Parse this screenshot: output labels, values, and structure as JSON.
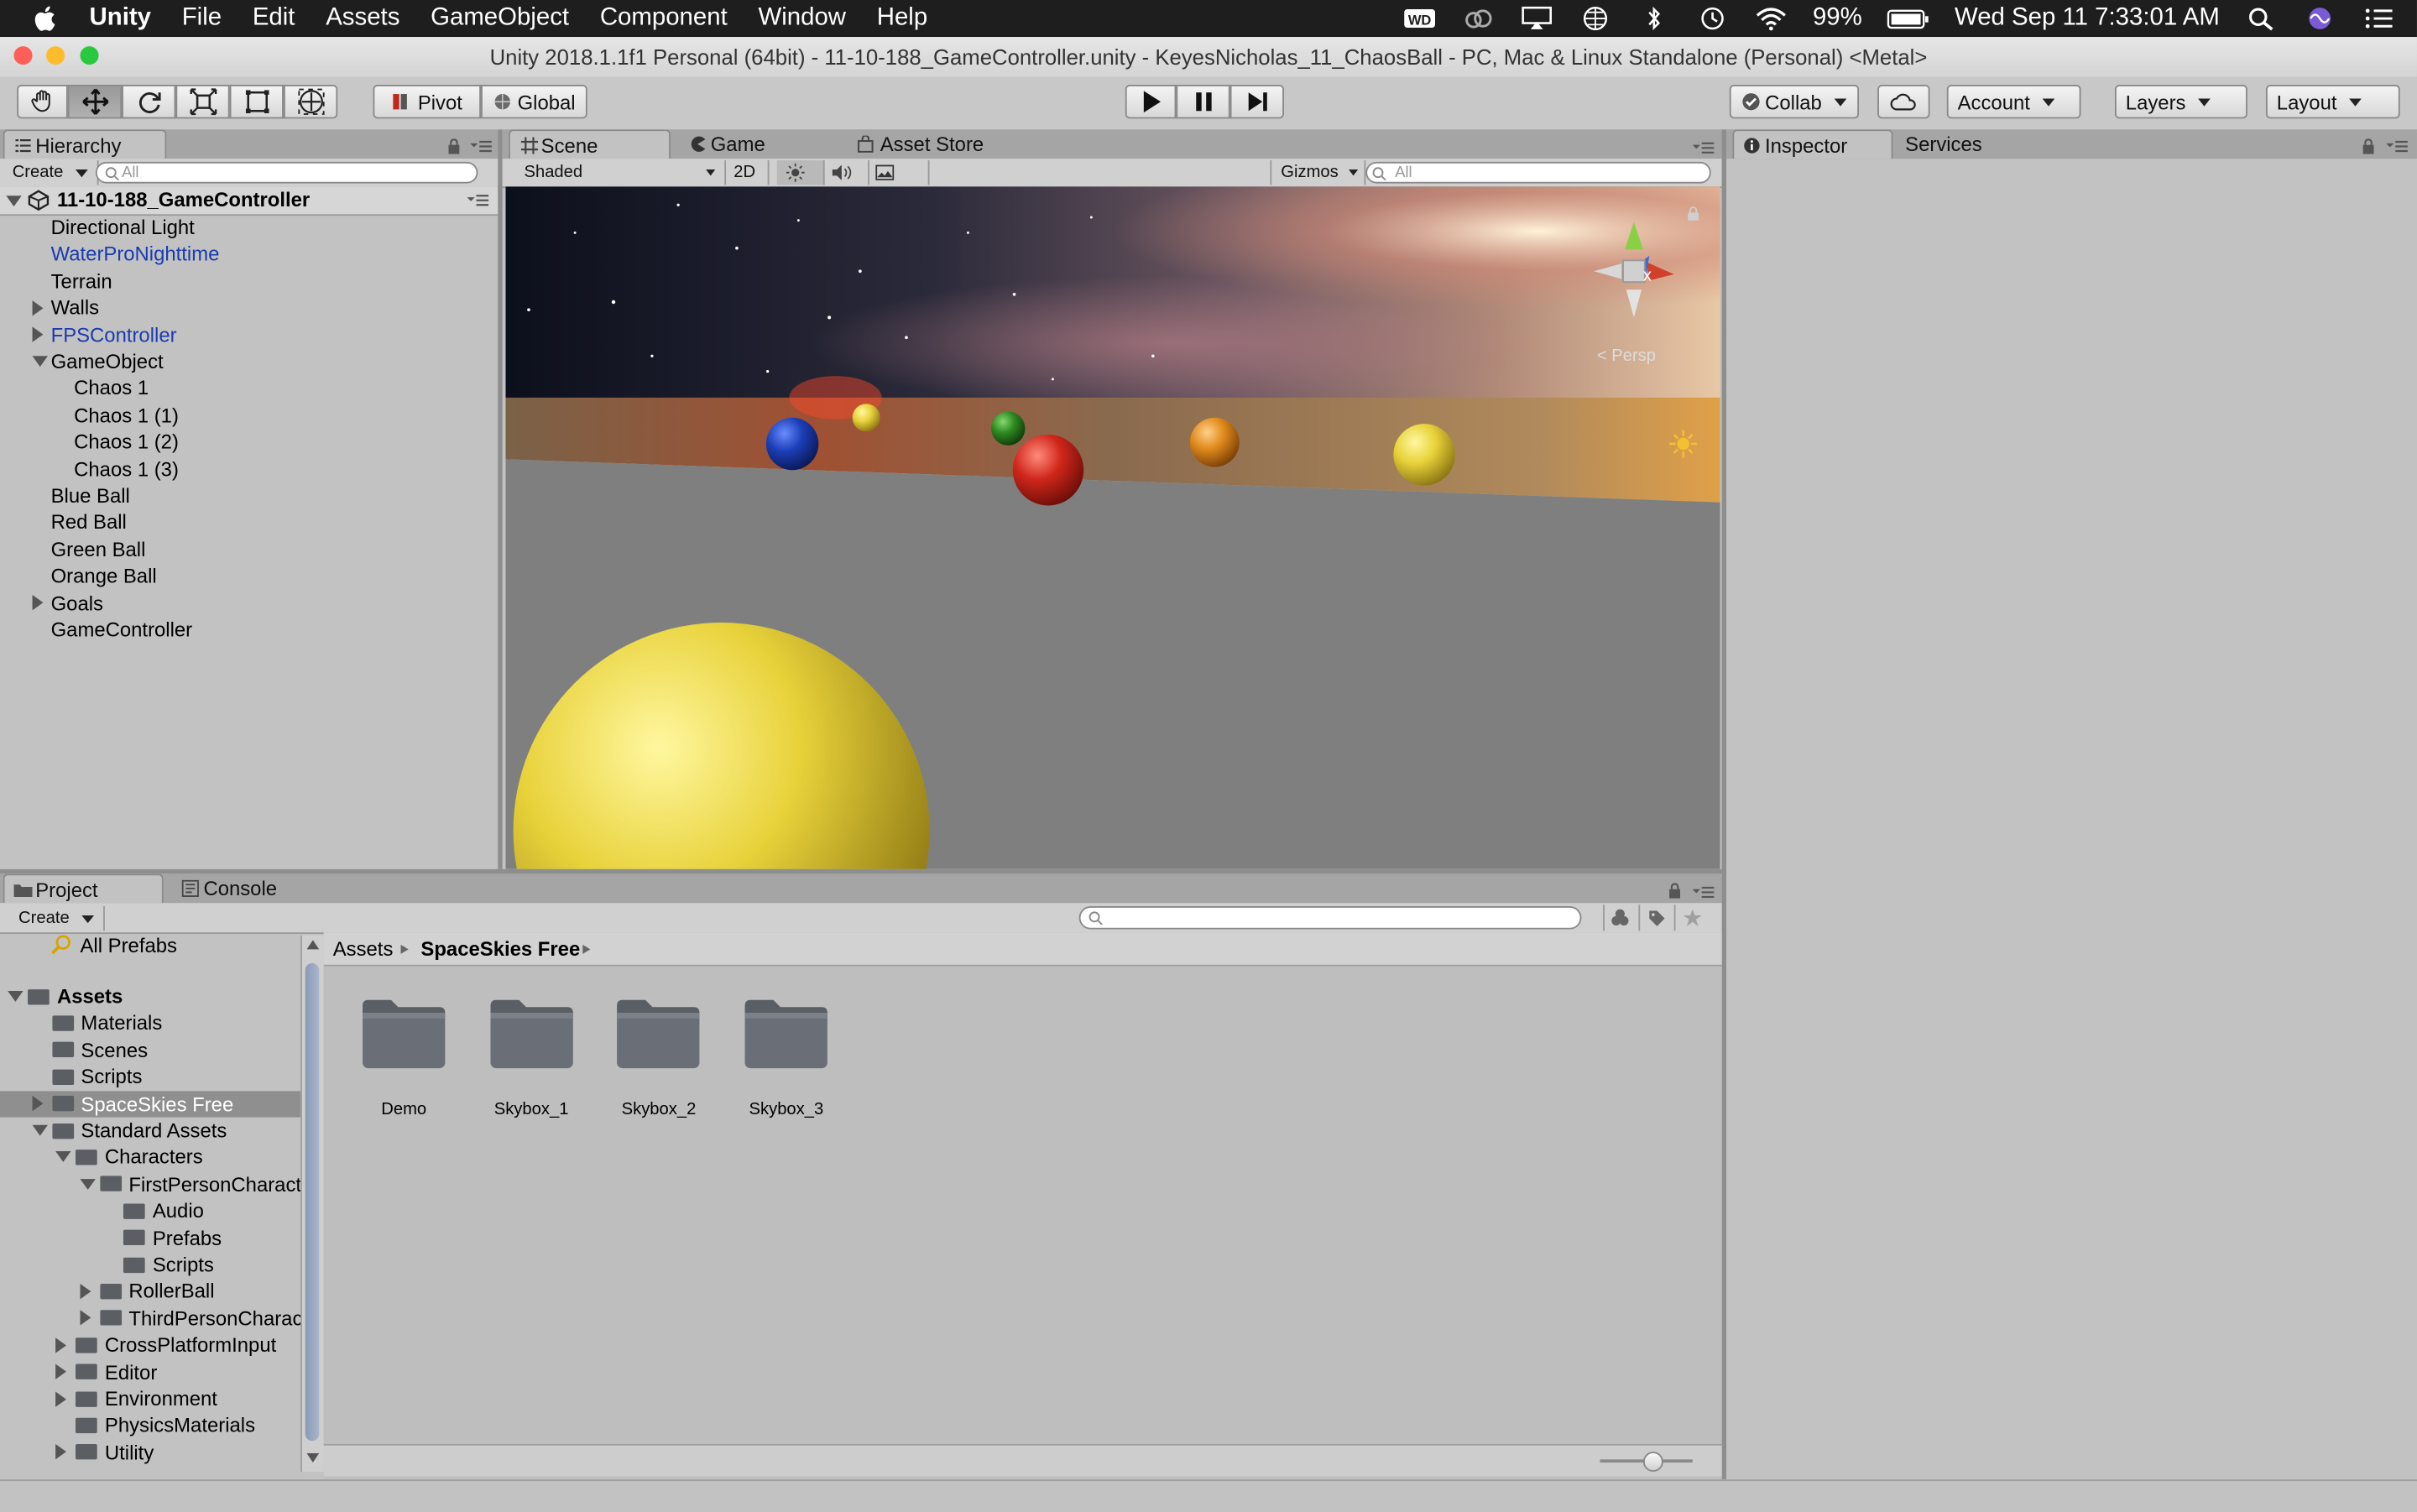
{
  "menubar": {
    "app": "Unity",
    "items": [
      "File",
      "Edit",
      "Assets",
      "GameObject",
      "Component",
      "Window",
      "Help"
    ],
    "battery": "99%",
    "clock": "Wed Sep 11  7:33:01 AM",
    "status_icons": [
      "wd-drive-icon",
      "creative-cloud-icon",
      "airplay-icon",
      "globe-icon",
      "bluetooth-icon",
      "time-machine-icon",
      "wifi-icon",
      "battery-icon",
      "spotlight-icon",
      "siri-icon",
      "notification-center-icon"
    ]
  },
  "window": {
    "title": "Unity 2018.1.1f1 Personal (64bit) - 11-10-188_GameController.unity - KeyesNicholas_11_ChaosBall - PC, Mac & Linux Standalone (Personal) <Metal>"
  },
  "toolbar": {
    "tools": [
      "hand-tool-icon",
      "move-tool-icon",
      "rotate-tool-icon",
      "scale-tool-icon",
      "rect-tool-icon",
      "transform-tool-icon"
    ],
    "active_tool": "move-tool-icon",
    "pivot": "Pivot",
    "global": "Global",
    "collab": "Collab",
    "account": "Account",
    "layers": "Layers",
    "layout": "Layout"
  },
  "hierarchy": {
    "tab": "Hierarchy",
    "create": "Create",
    "search_placeholder": "All",
    "scene": "11-10-188_GameController",
    "items": [
      {
        "label": "Directional Light",
        "depth": 0,
        "expander": "none",
        "prefab": false
      },
      {
        "label": "WaterProNighttime",
        "depth": 0,
        "expander": "none",
        "prefab": true
      },
      {
        "label": "Terrain",
        "depth": 0,
        "expander": "none",
        "prefab": false
      },
      {
        "label": "Walls",
        "depth": 0,
        "expander": "collapsed",
        "prefab": false
      },
      {
        "label": "FPSController",
        "depth": 0,
        "expander": "collapsed",
        "prefab": true
      },
      {
        "label": "GameObject",
        "depth": 0,
        "expander": "expanded",
        "prefab": false
      },
      {
        "label": "Chaos 1",
        "depth": 1,
        "expander": "none",
        "prefab": false
      },
      {
        "label": "Chaos 1 (1)",
        "depth": 1,
        "expander": "none",
        "prefab": false
      },
      {
        "label": "Chaos 1 (2)",
        "depth": 1,
        "expander": "none",
        "prefab": false
      },
      {
        "label": "Chaos 1 (3)",
        "depth": 1,
        "expander": "none",
        "prefab": false
      },
      {
        "label": "Blue Ball",
        "depth": 0,
        "expander": "none",
        "prefab": false
      },
      {
        "label": "Red Ball",
        "depth": 0,
        "expander": "none",
        "prefab": false
      },
      {
        "label": "Green Ball",
        "depth": 0,
        "expander": "none",
        "prefab": false
      },
      {
        "label": "Orange Ball",
        "depth": 0,
        "expander": "none",
        "prefab": false
      },
      {
        "label": "Goals",
        "depth": 0,
        "expander": "collapsed",
        "prefab": false
      },
      {
        "label": "GameController",
        "depth": 0,
        "expander": "none",
        "prefab": false
      }
    ]
  },
  "scene": {
    "tabs": [
      "Scene",
      "Game",
      "Asset Store"
    ],
    "active_tab": "Scene",
    "shading": "Shaded",
    "mode_2d": "2D",
    "gizmos": "Gizmos",
    "search_placeholder": "All",
    "persp_label": "< Persp",
    "axis_x": "x"
  },
  "inspector": {
    "tabs": [
      "Inspector",
      "Services"
    ],
    "active_tab": "Inspector"
  },
  "project": {
    "tabs": [
      "Project",
      "Console"
    ],
    "active_tab": "Project",
    "create": "Create",
    "favorites": "All Prefabs",
    "tree": [
      {
        "label": "Assets",
        "depth": 0,
        "expander": "expanded",
        "bold": true,
        "selected": false
      },
      {
        "label": "Materials",
        "depth": 1,
        "expander": "none",
        "bold": false,
        "selected": false
      },
      {
        "label": "Scenes",
        "depth": 1,
        "expander": "none",
        "bold": false,
        "selected": false
      },
      {
        "label": "Scripts",
        "depth": 1,
        "expander": "none",
        "bold": false,
        "selected": false
      },
      {
        "label": "SpaceSkies Free",
        "depth": 1,
        "expander": "collapsed",
        "bold": false,
        "selected": true
      },
      {
        "label": "Standard Assets",
        "depth": 1,
        "expander": "expanded",
        "bold": false,
        "selected": false
      },
      {
        "label": "Characters",
        "depth": 2,
        "expander": "expanded",
        "bold": false,
        "selected": false
      },
      {
        "label": "FirstPersonCharacte",
        "depth": 3,
        "expander": "expanded",
        "bold": false,
        "selected": false
      },
      {
        "label": "Audio",
        "depth": 4,
        "expander": "none",
        "bold": false,
        "selected": false
      },
      {
        "label": "Prefabs",
        "depth": 4,
        "expander": "none",
        "bold": false,
        "selected": false
      },
      {
        "label": "Scripts",
        "depth": 4,
        "expander": "none",
        "bold": false,
        "selected": false
      },
      {
        "label": "RollerBall",
        "depth": 3,
        "expander": "collapsed",
        "bold": false,
        "selected": false
      },
      {
        "label": "ThirdPersonCharac",
        "depth": 3,
        "expander": "collapsed",
        "bold": false,
        "selected": false
      },
      {
        "label": "CrossPlatformInput",
        "depth": 2,
        "expander": "collapsed",
        "bold": false,
        "selected": false
      },
      {
        "label": "Editor",
        "depth": 2,
        "expander": "collapsed",
        "bold": false,
        "selected": false
      },
      {
        "label": "Environment",
        "depth": 2,
        "expander": "collapsed",
        "bold": false,
        "selected": false
      },
      {
        "label": "PhysicsMaterials",
        "depth": 2,
        "expander": "none",
        "bold": false,
        "selected": false
      },
      {
        "label": "Utility",
        "depth": 2,
        "expander": "collapsed",
        "bold": false,
        "selected": false
      }
    ],
    "breadcrumb": [
      "Assets",
      "SpaceSkies Free"
    ],
    "folders": [
      "Demo",
      "Skybox_1",
      "Skybox_2",
      "Skybox_3"
    ]
  },
  "colors": {
    "prefab_text": "#1a3bb0",
    "selection": "#8f8f8f",
    "ball_yellow": "#e8d23a",
    "ball_red": "#d0261b",
    "ball_blue": "#1d3fb8",
    "ball_green": "#2f8a22",
    "ball_orange": "#e08a1c"
  }
}
